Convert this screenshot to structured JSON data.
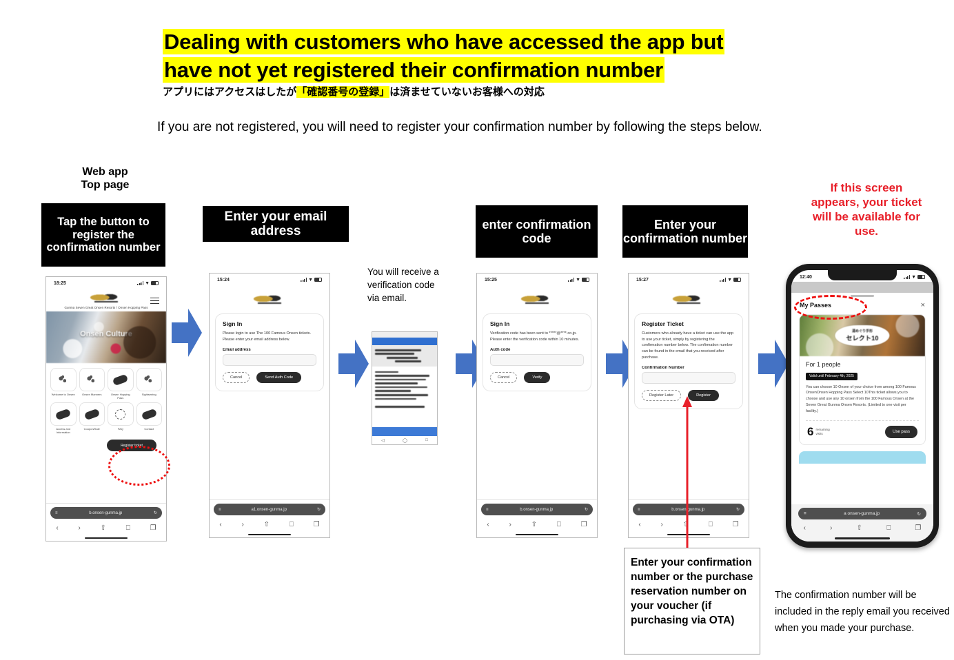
{
  "title": {
    "line1": "Dealing with customers who have accessed the app but",
    "line2": "have not yet registered their confirmation number"
  },
  "subtitle_jp": {
    "before": "アプリにはアクセスはしたが",
    "highlight": "「確認番号の登録」",
    "after": "は済ませていないお客様への対応"
  },
  "lead": "If you are not registered, you will need to register your confirmation number by following the steps below.",
  "steps": [
    {
      "above_label": "Web app\nTop page",
      "black_label": "Tap the button to register the confirmation number",
      "phone": {
        "time": "18:25",
        "brand_sub": "Gunma Seven Great Onsen Resorts / Onsen Hopping Pass",
        "hero_text": "Onsen Culture",
        "tiles": [
          {
            "caption": "Welcome to\nOnsen"
          },
          {
            "caption": "Onsen\nManners"
          },
          {
            "caption": "Onsen\nHopping Pass"
          },
          {
            "caption": "Sightseeing"
          },
          {
            "caption": "Access and\nInformation"
          },
          {
            "caption": "Coupon/Sale"
          },
          {
            "caption": "FAQ"
          },
          {
            "caption": "Contact"
          }
        ],
        "register_button": "Register ticket",
        "url": "b.onsen-gunma.jp"
      }
    },
    {
      "black_label": "Enter your email address",
      "phone": {
        "time": "15:24",
        "card_title": "Sign In",
        "card_body": "Please login to use The 100 Famous Onsen tickets. Please enter your email address below.",
        "field_label": "Email address",
        "field_value": "",
        "cancel_label": "Cancel",
        "submit_label": "Send Auth Code",
        "url": "a1.onsen-gunma.jp"
      }
    },
    {
      "black_label": "enter confirmation code",
      "note": "You will receive a verification code via email.",
      "phone": {
        "time": "15:25",
        "card_title": "Sign In",
        "card_body": "Verification code has been sent to *****@****.co.jp. Please enter the verification code within 10 minutes.",
        "field_label": "Auth code",
        "field_value": "",
        "cancel_label": "Cancel",
        "submit_label": "Verify",
        "url": "b.onsen-gunma.jp"
      }
    },
    {
      "black_label": "Enter your confirmation number",
      "phone": {
        "time": "15:27",
        "card_title": "Register Ticket",
        "card_body": "Customers who already have a ticket can use the app to use your ticket, simply by registering the confirmation number below. The confirmation number can be found in the email that you received after purchase.",
        "field_label": "Confirmation Number",
        "field_value": "",
        "cancel_label": "Register Later",
        "submit_label": "Register",
        "url": "b.onsen-gunma.jp"
      }
    }
  ],
  "callout": "Enter your confirmation number or the purchase reservation number on your voucher (if purchasing via OTA)",
  "red_note": "If this screen appears, your ticket will be available for use.",
  "bottom_note": "The confirmation number will be included in the reply email you received when you made your purchase.",
  "device": {
    "time": "12:40",
    "sheet_title": "My Passes",
    "close_icon": "×",
    "pass_badge_jp": "湯めぐり手形",
    "pass_badge_main": "セレクト10",
    "for_people": "For 1 people",
    "valid_until": "Valid until February 4th, 2025",
    "description": "You can choose 10 Onsen of your choice from among 100 Famous OnsenOnsen Hopping Pass Select 10This ticket allows you to choose and use any 10 onsen from the 100 Famous Onsen at the Seven Great Gunma Onsen Resorts. (Limited to one visit per facility.)",
    "remaining_count": "6",
    "remaining_label": "remaining\nvisits",
    "use_pass_label": "Use pass",
    "url": "a onsen-gunma.jp"
  },
  "email_shot": {
    "subject_lines": [
      "",
      "",
      ""
    ]
  },
  "colors": {
    "highlight": "#ffff00",
    "arrow_blue": "#4472c4",
    "red": "#e8202a",
    "black_label_bg": "#000000"
  }
}
